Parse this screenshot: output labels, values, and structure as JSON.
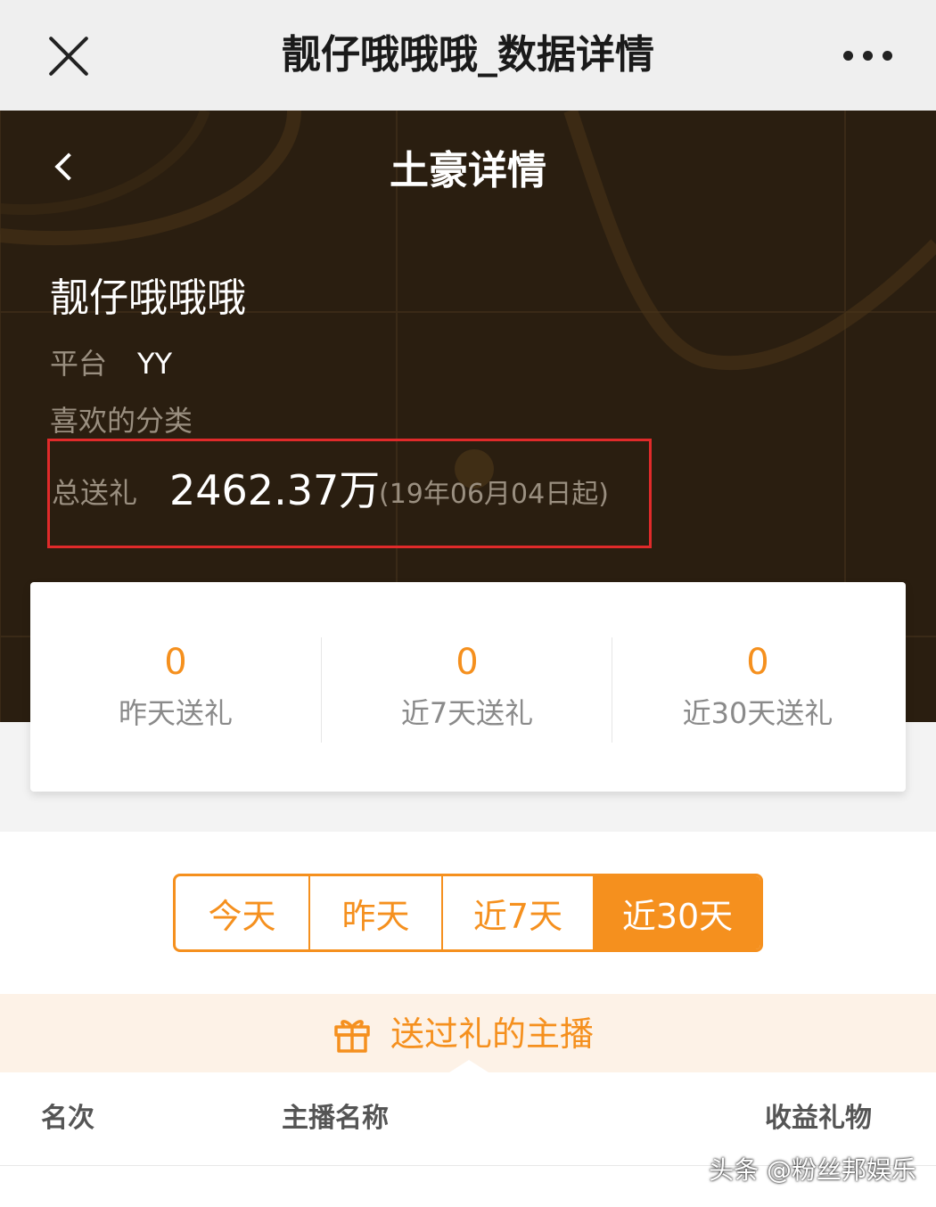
{
  "window": {
    "title": "靓仔哦哦哦_数据详情",
    "close_icon": "close-icon",
    "more_icon": "more-icon"
  },
  "header": {
    "title": "土豪详情",
    "back_icon": "chevron-left-icon"
  },
  "profile": {
    "name": "靓仔哦哦哦",
    "platform_label": "平台",
    "platform_value": "YY",
    "category_label": "喜欢的分类",
    "total_gift_label": "总送礼",
    "total_gift_value": "2462.37万",
    "total_gift_since": "(19年06月04日起)"
  },
  "stats": [
    {
      "value": "0",
      "label": "昨天送礼"
    },
    {
      "value": "0",
      "label": "近7天送礼"
    },
    {
      "value": "0",
      "label": "近30天送礼"
    }
  ],
  "period_tabs": {
    "items": [
      "今天",
      "昨天",
      "近7天",
      "近30天"
    ],
    "selected": "近30天"
  },
  "gift_section": {
    "title": "送过礼的主播",
    "icon": "gift-icon"
  },
  "table": {
    "columns": [
      "名次",
      "主播名称",
      "收益礼物"
    ]
  },
  "watermark": "头条 @粉丝邦娱乐",
  "colors": {
    "accent": "#f5901e",
    "hero_bg": "#2a1e10",
    "highlight": "#e02a2a"
  }
}
